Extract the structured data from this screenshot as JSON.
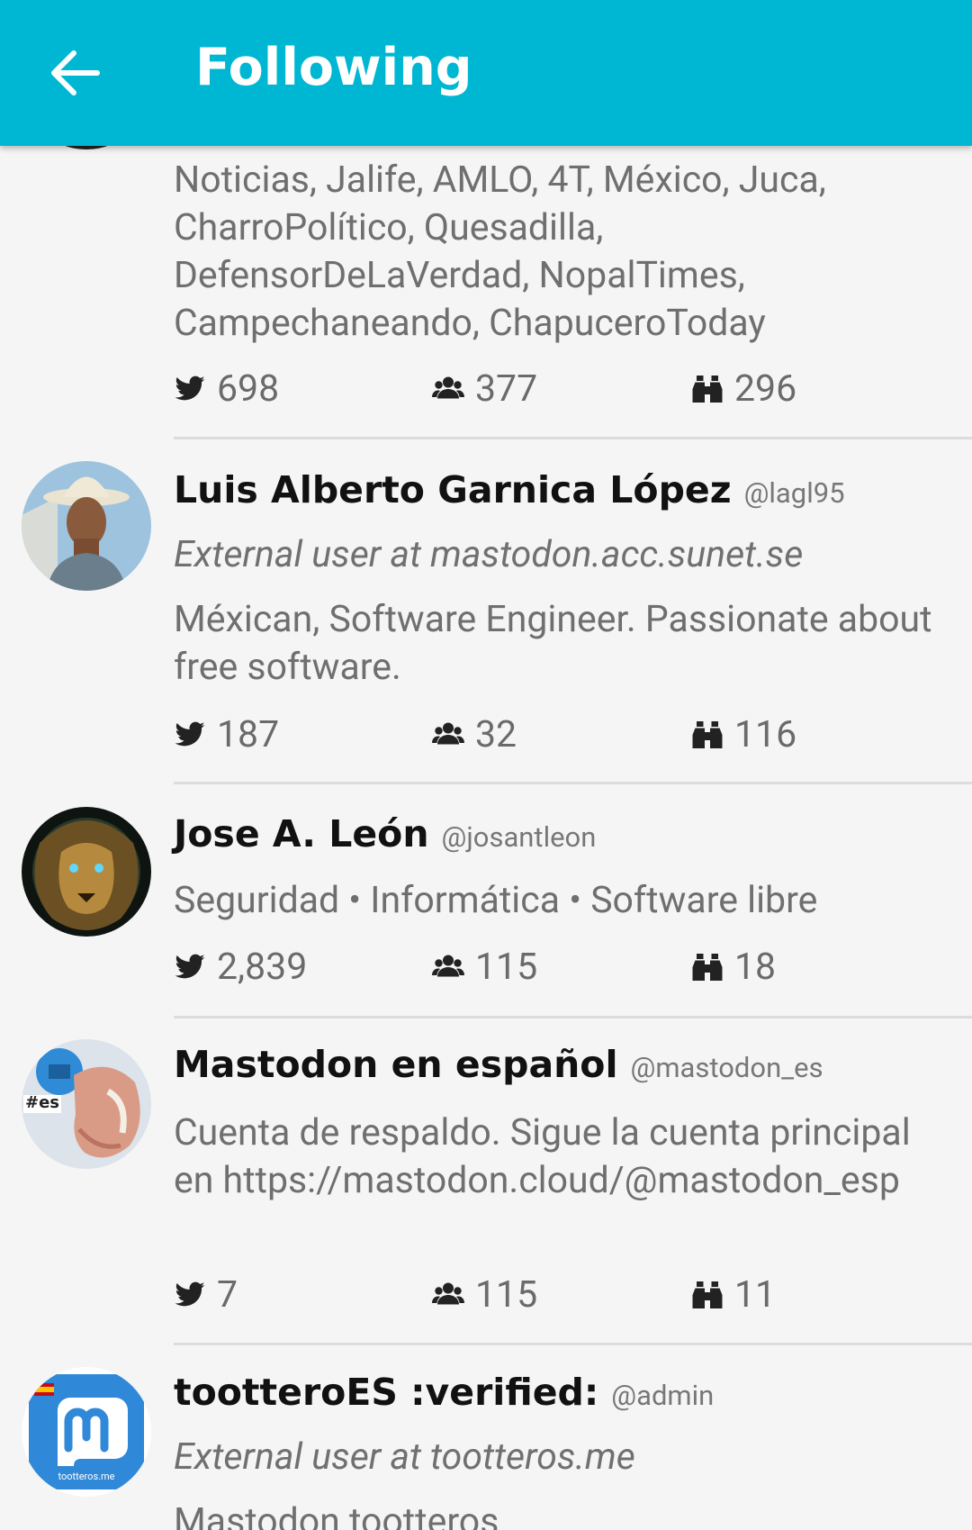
{
  "appbar": {
    "title": "Following"
  },
  "accounts": [
    {
      "bio": "Noticias, Jalife, AMLO, 4T, México, Juca, CharroPolítico, Quesadilla, DefensorDeLaVerdad, NopalTimes, Campechaneando, ChapuceroToday",
      "statuses": "698",
      "followers": "377",
      "following": "296"
    },
    {
      "display_name": "Luis Alberto Garnica López",
      "handle": "@lagl95",
      "external": "External user at mastodon.acc.sunet.se",
      "bio": "Méxican, Software Engineer. Passionate about free software.",
      "statuses": "187",
      "followers": "32",
      "following": "116"
    },
    {
      "display_name": "Jose A. León",
      "handle": "@josantleon",
      "bio": "Seguridad • Informática • Software libre",
      "statuses": "2,839",
      "followers": "115",
      "following": "18"
    },
    {
      "display_name": "Mastodon en español",
      "handle": "@mastodon_es",
      "bio": "Cuenta de respaldo. Sigue la cuenta principal en https://mastodon.cloud/@mastodon_esp",
      "avatar_tag": "#es",
      "statuses": "7",
      "followers": "115",
      "following": "11"
    },
    {
      "display_name": "tootteroES  :verified:",
      "handle": "@admin",
      "external": "External user at tootteros.me",
      "bio": "Mastodon tootteros",
      "avatar_caption": "tootteros.me"
    }
  ],
  "icons": {
    "back": "arrow-left-icon",
    "statuses": "bird-icon",
    "followers": "people-icon",
    "following": "binoculars-icon"
  },
  "colors": {
    "appbar": "#00b7d3",
    "background": "#f5f5f5"
  }
}
